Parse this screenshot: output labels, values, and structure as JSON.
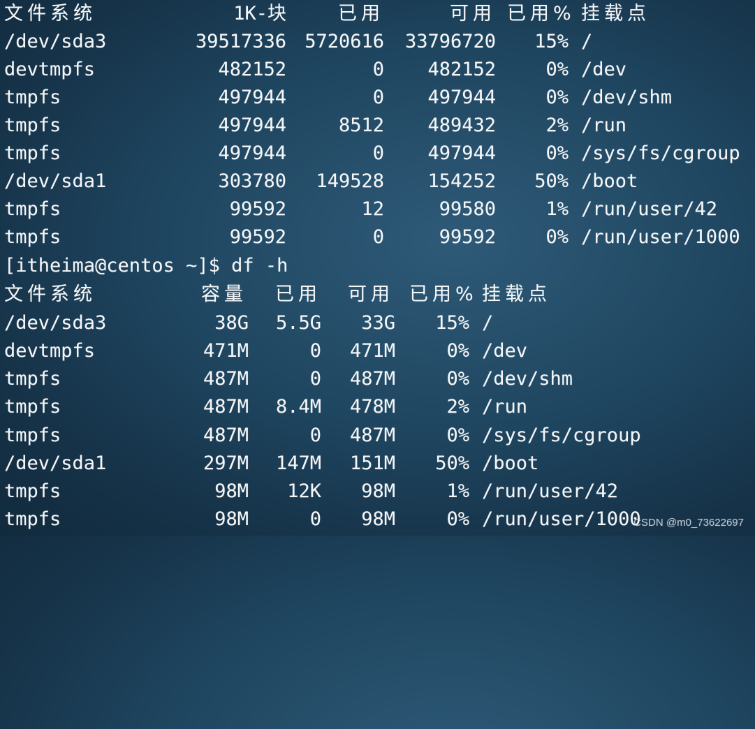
{
  "colors": {
    "background": "#1f4660",
    "text": "#f4f6f8"
  },
  "section1": {
    "headers": [
      "文件系统",
      "1K-块",
      "已用",
      "可用",
      "已用%",
      "挂载点"
    ],
    "rows": [
      [
        "/dev/sda3",
        "39517336",
        "5720616",
        "33796720",
        "15%",
        "/"
      ],
      [
        "devtmpfs",
        "482152",
        "0",
        "482152",
        "0%",
        "/dev"
      ],
      [
        "tmpfs",
        "497944",
        "0",
        "497944",
        "0%",
        "/dev/shm"
      ],
      [
        "tmpfs",
        "497944",
        "8512",
        "489432",
        "2%",
        "/run"
      ],
      [
        "tmpfs",
        "497944",
        "0",
        "497944",
        "0%",
        "/sys/fs/cgroup"
      ],
      [
        "/dev/sda1",
        "303780",
        "149528",
        "154252",
        "50%",
        "/boot"
      ],
      [
        "tmpfs",
        "99592",
        "12",
        "99580",
        "1%",
        "/run/user/42"
      ],
      [
        "tmpfs",
        "99592",
        "0",
        "99592",
        "0%",
        "/run/user/1000"
      ]
    ]
  },
  "prompt": {
    "text": "[itheima@centos ~]$ df -h"
  },
  "section2": {
    "headers": [
      "文件系统",
      "容量",
      "已用",
      "可用",
      "已用%",
      "挂载点"
    ],
    "rows": [
      [
        "/dev/sda3",
        "38G",
        "5.5G",
        "33G",
        "15%",
        "/"
      ],
      [
        "devtmpfs",
        "471M",
        "0",
        "471M",
        "0%",
        "/dev"
      ],
      [
        "tmpfs",
        "487M",
        "0",
        "487M",
        "0%",
        "/dev/shm"
      ],
      [
        "tmpfs",
        "487M",
        "8.4M",
        "478M",
        "2%",
        "/run"
      ],
      [
        "tmpfs",
        "487M",
        "0",
        "487M",
        "0%",
        "/sys/fs/cgroup"
      ],
      [
        "/dev/sda1",
        "297M",
        "147M",
        "151M",
        "50%",
        "/boot"
      ],
      [
        "tmpfs",
        "98M",
        "12K",
        "98M",
        "1%",
        "/run/user/42"
      ],
      [
        "tmpfs",
        "98M",
        "0",
        "98M",
        "0%",
        "/run/user/1000"
      ]
    ]
  },
  "watermark": "CSDN @m0_73622697"
}
